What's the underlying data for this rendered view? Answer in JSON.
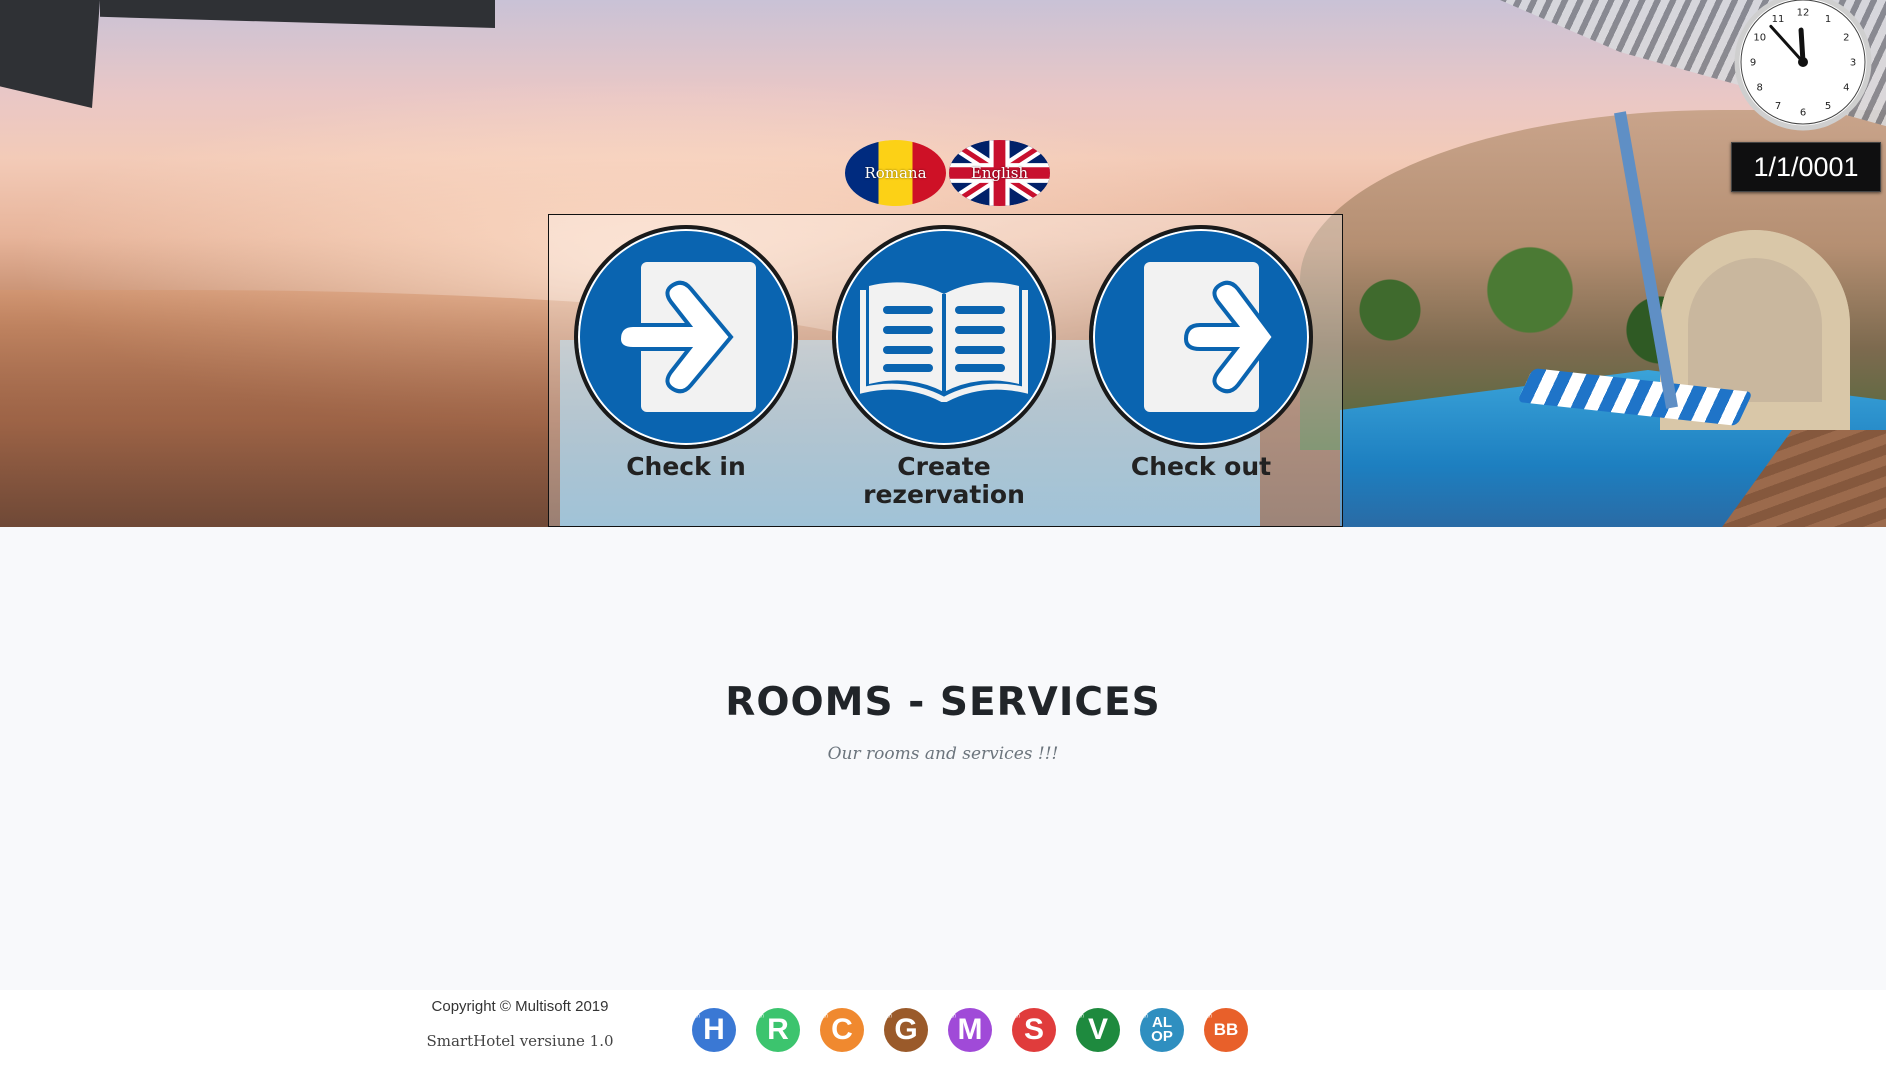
{
  "language": {
    "romana_label": "Romana",
    "english_label": "English"
  },
  "actions": {
    "check_in": "Check in",
    "create_line1": "Create",
    "create_line2": "rezervation",
    "check_out": "Check out"
  },
  "clock": {
    "hour": 11,
    "minute": 53,
    "numbers": [
      "12",
      "1",
      "2",
      "3",
      "4",
      "5",
      "6",
      "7",
      "8",
      "9",
      "10",
      "11"
    ]
  },
  "date_display": "1/1/0001",
  "services": {
    "title": "ROOMS - SERVICES",
    "subtitle": "Our rooms and services !!!"
  },
  "footer": {
    "copyright": "Copyright © Multisoft 2019",
    "version": "SmartHotel versiune 1.0",
    "apps": [
      {
        "letter": "H",
        "tag": "SOLON",
        "color": "#3a78d4"
      },
      {
        "letter": "R",
        "tag": "SOLON",
        "color": "#3cc46e"
      },
      {
        "letter": "C",
        "tag": "SOLON",
        "color": "#f0892f"
      },
      {
        "letter": "G",
        "tag": "SOLON",
        "color": "#9a5a2a"
      },
      {
        "letter": "M",
        "tag": "SOLON",
        "color": "#a04ad8"
      },
      {
        "letter": "S",
        "tag": "SOLON",
        "color": "#e03c3c"
      },
      {
        "letter": "V",
        "tag": "SOLON",
        "color": "#1e8a3e"
      },
      {
        "letter_top": "AL",
        "letter_bottom": "OP",
        "tag": "SOLON",
        "color": "#2f8fc0"
      },
      {
        "letter": "BB",
        "tag": "SOLON",
        "color": "#e8602a"
      }
    ]
  },
  "icons": {
    "check_in": "arrow-into-door-icon",
    "create": "open-book-icon",
    "check_out": "arrow-out-door-icon"
  },
  "colors": {
    "action_blue": "#0a64b0",
    "date_bg": "#0f0f10",
    "title_text": "#212529"
  }
}
